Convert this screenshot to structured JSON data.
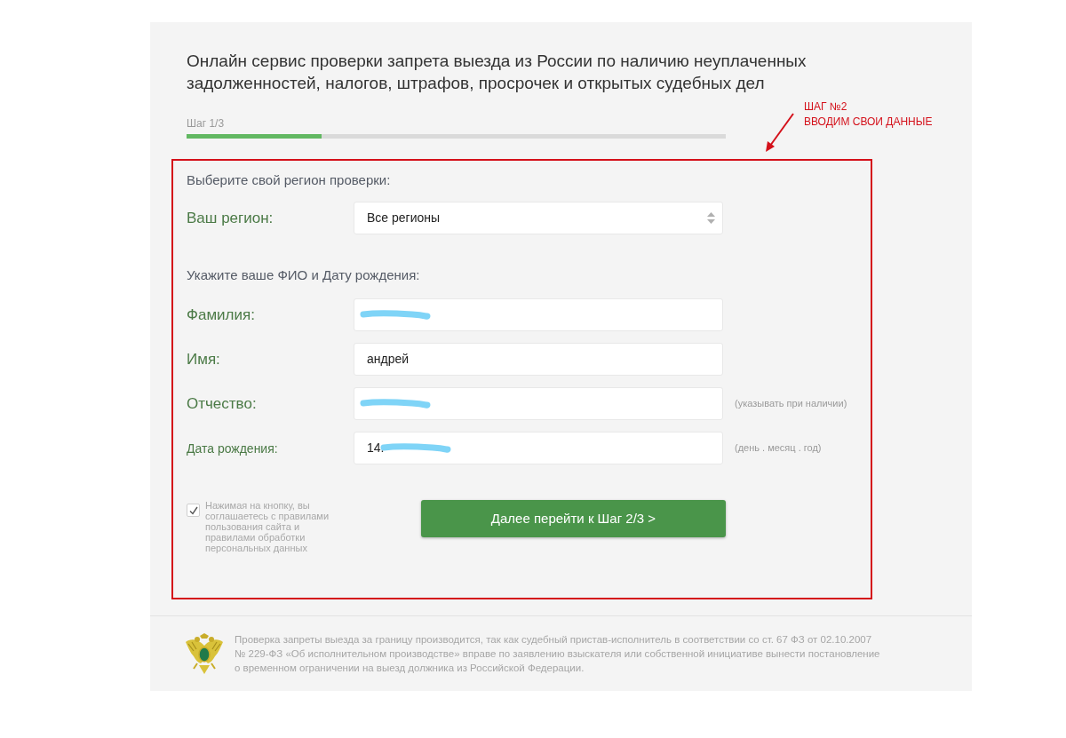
{
  "title_lines": [
    "Онлайн сервис проверки запрета выезда из России по наличию неуплаченных",
    "задолженностей, налогов, штрафов, просрочек и открытых судебных дел"
  ],
  "progress": {
    "label": "Шаг 1/3",
    "level": 0.25
  },
  "annotation": {
    "lines": [
      "ШАГ №2",
      "ВВОДИМ СВОИ ДАННЫЕ"
    ]
  },
  "region_section": {
    "heading": "Выберите свой регион проверки:",
    "label": "Ваш регион:",
    "value": "Все регионы"
  },
  "name_section": {
    "heading": "Укажите ваше ФИО и Дату рождения:",
    "fields": [
      {
        "kind": "large",
        "label": "Фамилия:",
        "redacted": true
      },
      {
        "kind": "large",
        "label": "Имя:",
        "value": "андрей",
        "redacted": false
      },
      {
        "kind": "large",
        "label": "Отчество:",
        "redacted": true,
        "hint": "(указывать при наличии)"
      },
      {
        "kind": "small",
        "label": "Дата рождения:",
        "value": "14.",
        "redacted": true,
        "hint": "(день . месяц . год)"
      }
    ]
  },
  "consent": {
    "checked": true,
    "lines": [
      "Нажимая на кнопку, вы",
      "соглашаетесь с правилами",
      "пользования сайта и",
      "правилами обработки",
      "персональных данных"
    ]
  },
  "submit_button": "Далее перейти к Шаг 2/3 >",
  "footer": {
    "lines": [
      "Проверка запреты выезда за границу производится, так как судебный пристав-исполнитель в соответствии со ст. 67 ФЗ от 02.10.2007",
      "№ 229-ФЗ «Об исполнительном производстве» вправе по заявлению взыскателя или собственной инициативе вынести постановление",
      "о временном ограничении на выезд должника из Российской Федерации."
    ]
  }
}
